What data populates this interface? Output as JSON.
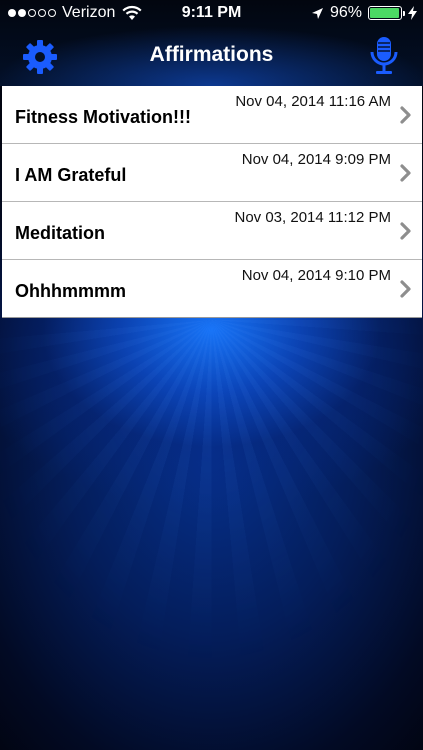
{
  "status_bar": {
    "carrier": "Verizon",
    "time": "9:11 PM",
    "battery_percent": "96%",
    "battery_level": 0.96,
    "signal_bars_filled": 2,
    "signal_bars_total": 5
  },
  "nav": {
    "title": "Affirmations",
    "left_icon": "gear-icon",
    "right_icon": "microphone-icon"
  },
  "colors": {
    "accent": "#1a5cff",
    "battery": "#4cd964"
  },
  "affirmations": [
    {
      "title": "Fitness Motivation!!!",
      "date": "Nov 04, 2014 11:16 AM"
    },
    {
      "title": "I AM Grateful",
      "date": "Nov 04, 2014 9:09 PM"
    },
    {
      "title": "Meditation",
      "date": "Nov 03, 2014 11:12 PM"
    },
    {
      "title": "Ohhhmmmm",
      "date": "Nov 04, 2014 9:10 PM"
    }
  ]
}
